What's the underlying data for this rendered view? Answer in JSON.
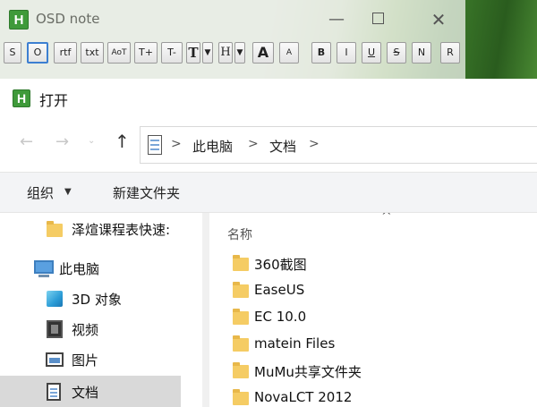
{
  "osd_window": {
    "logo_letter": "H",
    "title": "OSD note",
    "controls": {
      "minimize": "—",
      "maximize": "",
      "close": "✕"
    },
    "toolbar": [
      {
        "label": "S",
        "name": "tb-s-button"
      },
      {
        "label": "O",
        "name": "tb-o-button",
        "selected": true
      },
      {
        "label": "rtf",
        "name": "tb-rtf-button"
      },
      {
        "label": "txt",
        "name": "tb-txt-button"
      },
      {
        "label": "AoT",
        "name": "tb-aot-button"
      },
      {
        "label": "T+",
        "name": "tb-tplus-button"
      },
      {
        "label": "T-",
        "name": "tb-tminus-button"
      },
      {
        "label": "T",
        "name": "tb-font-button"
      },
      {
        "label": "▼",
        "name": "tb-font-dropdown"
      },
      {
        "label": "H",
        "name": "tb-height-button"
      },
      {
        "label": "▼",
        "name": "tb-height-dropdown"
      },
      {
        "label": "A",
        "name": "tb-size-up-button"
      },
      {
        "label": "A",
        "name": "tb-size-down-button"
      },
      {
        "label": "B",
        "name": "tb-bold-button"
      },
      {
        "label": "I",
        "name": "tb-italic-button"
      },
      {
        "label": "U",
        "name": "tb-underline-button"
      },
      {
        "label": "S",
        "name": "tb-strike-button"
      },
      {
        "label": "N",
        "name": "tb-normal-button"
      },
      {
        "label": "R",
        "name": "tb-reset-button"
      }
    ]
  },
  "dialog": {
    "logo_letter": "H",
    "title": "打开",
    "nav": {
      "back": "←",
      "forward": "→",
      "recent": "⌄",
      "up": "↑"
    },
    "breadcrumb": [
      {
        "label": "此电脑"
      },
      {
        "label": "文档"
      }
    ],
    "breadcrumb_sep": ">",
    "commands": {
      "organize": "组织",
      "organize_caret": "▼",
      "new_folder": "新建文件夹"
    },
    "sidebar": [
      {
        "label": "泽煊课程表快速:",
        "icon": "folder-icon"
      },
      {
        "label": "此电脑",
        "icon": "computer-icon"
      },
      {
        "label": "3D 对象",
        "icon": "3d-objects-icon"
      },
      {
        "label": "视频",
        "icon": "video-icon"
      },
      {
        "label": "图片",
        "icon": "pictures-icon"
      },
      {
        "label": "文档",
        "icon": "documents-icon",
        "selected": true
      }
    ],
    "file_list": {
      "sort_indicator": "^",
      "column_name": "名称",
      "items": [
        {
          "name": "360截图"
        },
        {
          "name": "EaseUS"
        },
        {
          "name": "EC 10.0"
        },
        {
          "name": "matein Files"
        },
        {
          "name": "MuMu共享文件夹"
        },
        {
          "name": "NovaLCT 2012"
        }
      ]
    }
  }
}
